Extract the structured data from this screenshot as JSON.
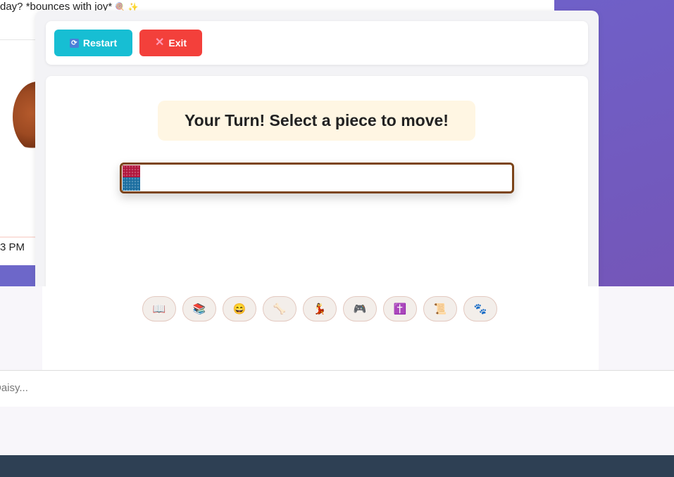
{
  "chat": {
    "top_message": "day? *bounces with joy*",
    "top_emojis": "🍭 ✨",
    "timestamp": "3 PM",
    "input_placeholder": "Daisy..."
  },
  "toolbar": {
    "restart_label": "Restart",
    "restart_icon": "🔄",
    "exit_label": "Exit",
    "exit_icon": "✕"
  },
  "game": {
    "status": "Your Turn! Select a piece to move!",
    "pieces": [
      {
        "color": "#b0153c",
        "name": "red-piece"
      },
      {
        "color": "#1a6da0",
        "name": "blue-piece"
      }
    ]
  },
  "action_icons": [
    {
      "name": "book-icon",
      "glyph": "📖"
    },
    {
      "name": "books-icon",
      "glyph": "📚"
    },
    {
      "name": "laughing-face-icon",
      "glyph": "😄"
    },
    {
      "name": "bone-icon",
      "glyph": "🦴"
    },
    {
      "name": "dancer-icon",
      "glyph": "💃"
    },
    {
      "name": "game-controller-icon",
      "glyph": "🎮"
    },
    {
      "name": "cross-icon",
      "glyph": "✝️"
    },
    {
      "name": "scroll-icon",
      "glyph": "📜"
    },
    {
      "name": "paw-prints-icon",
      "glyph": "🐾"
    }
  ],
  "colors": {
    "restart": "#17bed3",
    "exit": "#f3403b",
    "board_border": "#7c4419",
    "banner_bg": "#fff6e3",
    "footer": "#2e4054",
    "accent_purple": "#6f60c8"
  }
}
